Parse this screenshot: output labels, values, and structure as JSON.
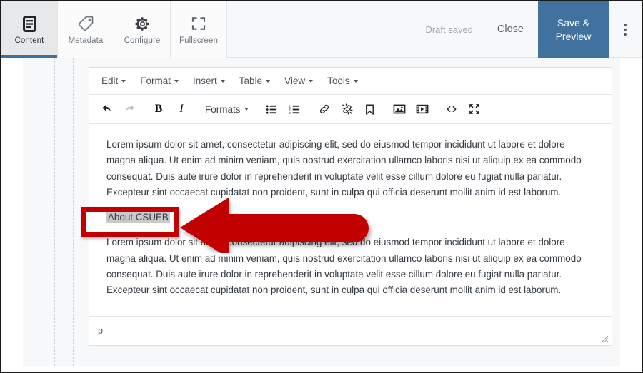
{
  "appbar": {
    "tabs": [
      {
        "label": "Content",
        "icon": "document-lines-icon",
        "active": true
      },
      {
        "label": "Metadata",
        "icon": "tag-icon",
        "active": false
      },
      {
        "label": "Configure",
        "icon": "gear-icon",
        "active": false
      },
      {
        "label": "Fullscreen",
        "icon": "expand-corners-icon",
        "active": false
      }
    ],
    "draft_status": "Draft saved",
    "close_label": "Close",
    "save_preview_line1": "Save &",
    "save_preview_line2": "Preview",
    "overflow_icon": "kebab-menu-icon",
    "active_tab_accent": "#3d72a0",
    "save_button_color": "#41729f"
  },
  "editor": {
    "menubar": [
      {
        "label": "Edit"
      },
      {
        "label": "Format"
      },
      {
        "label": "Insert"
      },
      {
        "label": "Table"
      },
      {
        "label": "View"
      },
      {
        "label": "Tools"
      }
    ],
    "toolbar": [
      {
        "name": "undo-icon",
        "title": "Undo",
        "disabled": false
      },
      {
        "name": "redo-icon",
        "title": "Redo",
        "disabled": true
      },
      {
        "name": "bold-icon",
        "title": "Bold",
        "disabled": false
      },
      {
        "name": "italic-icon",
        "title": "Italic",
        "disabled": false
      }
    ],
    "formats_label": "Formats",
    "toolbar2": [
      {
        "name": "bullet-list-icon",
        "title": "Bullet list"
      },
      {
        "name": "numbered-list-icon",
        "title": "Numbered list"
      },
      {
        "name": "link-icon",
        "title": "Insert/edit link"
      },
      {
        "name": "unlink-icon",
        "title": "Remove link"
      },
      {
        "name": "anchor-icon",
        "title": "Anchor"
      },
      {
        "name": "image-icon",
        "title": "Insert image"
      },
      {
        "name": "media-icon",
        "title": "Insert media"
      },
      {
        "name": "source-code-icon",
        "title": "Source code"
      },
      {
        "name": "fullscreen-icon",
        "title": "Fullscreen"
      }
    ],
    "body": {
      "paragraph_1": "Lorem ipsum dolor sit amet, consectetur adipiscing elit, sed do eiusmod tempor incididunt ut labore et dolore magna aliqua. Ut enim ad minim veniam, quis nostrud exercitation ullamco laboris nisi ut aliquip ex ea commodo consequat. Duis aute irure dolor in reprehenderit in voluptate velit esse cillum dolore eu fugiat nulla pariatur. Excepteur sint occaecat cupidatat non proident, sunt in culpa qui officia deserunt mollit anim id est laborum.",
      "selected_text": "About CSUEB",
      "paragraph_2": "Lorem ipsum dolor sit amet, consectetur adipiscing elit, sed do eiusmod tempor incididunt ut labore et dolore magna aliqua. Ut enim ad minim veniam, quis nostrud exercitation ullamco laboris nisi ut aliquip ex ea commodo consequat. Duis aute irure dolor in reprehenderit in voluptate velit esse cillum dolore eu fugiat nulla pariatur. Excepteur sint occaecat cupidatat non proident, sunt in culpa qui officia deserunt mollit anim id est laborum."
    },
    "statusbar": {
      "element_path": "p",
      "resize_handle_icon": "resize-grip-icon"
    }
  },
  "annotations": {
    "highlight_color": "#c20000",
    "callout_box_target": "About CSUEB",
    "arrow_icon": "left-pointing-arrow"
  }
}
